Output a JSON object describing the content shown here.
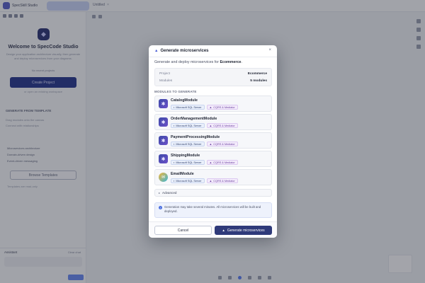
{
  "background": {
    "brand_text": "SpecSkill Studio",
    "top_tab": "Untitled",
    "welcome_title": "Welcome to SpecCode Studio",
    "welcome_sub": "Design your application architecture visually, then generate and deploy microservices from your diagrams.",
    "recent_label": "No recent projects",
    "create_button": "Create Project",
    "create_note": "or open an existing workspace",
    "section_heading": "GENERATE FROM TEMPLATE",
    "feature_lines": [
      "Drag modules onto the canvas",
      "Connect with relationships"
    ],
    "list_items": [
      "Microservices architecture",
      "Domain-driven design",
      "Event-driven messaging"
    ],
    "browse_button": "Browse Templates",
    "tiny_note": "Templates are read-only",
    "footer_title": "Assistant",
    "footer_right": "Clear chat"
  },
  "modal": {
    "title": "Generate microservices",
    "title_icon": "▲",
    "close_label": "×",
    "desc_prefix": "Generate and deploy microservices for",
    "desc_project": "Ecommerce",
    "desc_suffix": ".",
    "info": {
      "project_label": "Project",
      "project_value": "Ecommerce",
      "modules_label": "Modules",
      "modules_value": "5 modules"
    },
    "section_label": "MODULES TO GENERATE",
    "modules": [
      {
        "name": "CatalogModule",
        "db": "Microsoft SQL Server",
        "pattern": "CQRS & Mediator",
        "icon": "cube-icon"
      },
      {
        "name": "OrderManagementModule",
        "db": "Microsoft SQL Server",
        "pattern": "CQRS & Mediator",
        "icon": "cube-icon"
      },
      {
        "name": "PaymentProcessingModule",
        "db": "Microsoft SQL Server",
        "pattern": "CQRS & Mediator",
        "icon": "cube-icon"
      },
      {
        "name": "ShippingModule",
        "db": "Microsoft SQL Server",
        "pattern": "CQRS & Mediator",
        "icon": "cube-icon"
      },
      {
        "name": "EmailModule",
        "db": "Microsoft SQL Server",
        "pattern": "CQRS & Mediator",
        "icon": "mail-icon"
      }
    ],
    "advanced_label": "Advanced",
    "notice_text": "Generation may take several minutes. All microservices will be built and deployed.",
    "cancel_label": "Cancel",
    "generate_label": "Generate microservices"
  },
  "colors": {
    "primary": "#2f3a7a",
    "accent": "#4b5fd6",
    "db_tag": "#eaf0fb",
    "cqrs_tag": "#f3ebfb"
  }
}
